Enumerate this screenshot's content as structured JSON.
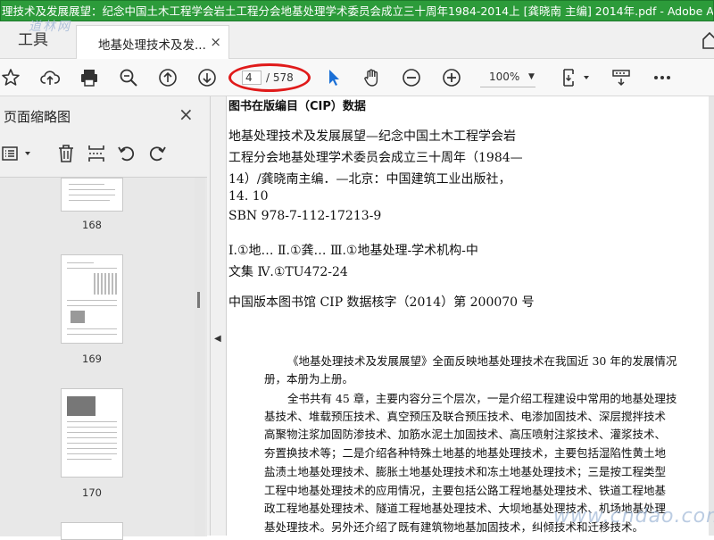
{
  "window": {
    "title": "理技术及发展展望：纪念中国土木工程学会岩土工程分会地基处理学术委员会成立三十周年1984-2014上 [龚晓南 主编] 2014年.pdf - Adobe Acrobat Pro"
  },
  "tabs": {
    "tools_label": "工具",
    "watermark_text": "道林网",
    "doc_tab_label": "地基处理技术及发...",
    "close_glyph": "×"
  },
  "toolbar": {
    "page_current": "4",
    "page_total": "/ 578",
    "zoom": "100%",
    "icons": [
      "bookmark-star-icon",
      "cloud-upload-icon",
      "print-icon",
      "zoom-search-icon",
      "page-up-icon",
      "page-down-icon",
      "select-arrow-icon",
      "hand-icon",
      "zoom-out-icon",
      "zoom-in-icon",
      "fit-page-icon",
      "keyboard-more-icon",
      "more-icon"
    ],
    "highlight_color": "#e01a1a"
  },
  "leftpane": {
    "title": "页面缩略图",
    "close_glyph": "×",
    "thumbnails": [
      {
        "label": "168"
      },
      {
        "label": "169"
      },
      {
        "label": "170"
      }
    ]
  },
  "document": {
    "cip_title": "图书在版编目（CIP）数据",
    "cip_lines": [
      "地基处理技术及发展展望—纪念中国土木工程学会岩",
      "工程分会地基处理学术委员会成立三十周年（1984—",
      "14）/龚晓南主编．—北京：中国建筑工业出版社，",
      "14. 10",
      "SBN 978-7-112-17213-9",
      "Ⅰ.①地…   Ⅱ.①龚…   Ⅲ.①地基处理-学术机构-中",
      "文集   Ⅳ.①TU472-24",
      "中国版本图书馆 CIP 数据核字（2014）第 200070 号"
    ],
    "body_lines": [
      "《地基处理技术及发展展望》全面反映地基处理技术在我国近 30 年的发展情况",
      "册，本册为上册。",
      "全书共有 45 章，主要内容分三个层次，一是介绍工程建设中常用的地基处理技",
      "基技术、堆载预压技术、真空预压及联合预压技术、电渗加固技术、深层搅拌技术",
      "高聚物注浆加固防渗技术、加筋水泥土加固技术、高压喷射注浆技术、灌浆技术、",
      "夯置换技术等；二是介绍各种特殊土地基的地基处理技术，主要包括湿陷性黄土地",
      "盐渍土地基处理技术、膨胀土地基处理技术和冻土地基处理技术；三是按工程类型",
      "工程中地基处理技术的应用情况，主要包括公路工程地基处理技术、铁道工程地基",
      "政工程地基处理技术、隧道工程地基处理技术、大坝地基处理技术、机场地基处理",
      "基处理技术。另外还介绍了既有建筑物地基加固技术，纠倾技术和迁移技术。"
    ],
    "watermark_text": "www.cndao.com"
  }
}
